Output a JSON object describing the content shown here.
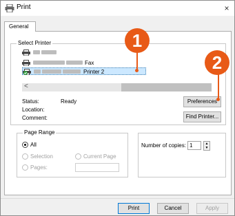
{
  "window": {
    "title": "Print",
    "close_glyph": "×"
  },
  "tabs": [
    {
      "label": "General"
    }
  ],
  "select_printer": {
    "legend": "Select Printer",
    "printers": [
      {
        "label": "",
        "selected": false
      },
      {
        "label": "Fax",
        "selected": false
      },
      {
        "label": "Printer 2",
        "selected": true
      }
    ],
    "scroll_left_glyph": "<"
  },
  "status": {
    "status_label": "Status:",
    "status_value": "Ready",
    "location_label": "Location:",
    "location_value": "",
    "comment_label": "Comment:",
    "comment_value": ""
  },
  "buttons": {
    "preferences": "Preferences",
    "find_printer": "Find Printer...",
    "print": "Print",
    "cancel": "Cancel",
    "apply": "Apply"
  },
  "page_range": {
    "legend": "Page Range",
    "all": "All",
    "selection": "Selection",
    "current_page": "Current Page",
    "pages": "Pages:",
    "pages_value": ""
  },
  "copies": {
    "label": "Number of copies:",
    "value": "1"
  },
  "callouts": [
    {
      "number": "1"
    },
    {
      "number": "2"
    }
  ],
  "colors": {
    "accent": "#e85a17",
    "selection": "#cce8ff"
  },
  "icons": {
    "app": "printer-icon",
    "printer": "printer-icon",
    "default_check": "check-icon"
  }
}
